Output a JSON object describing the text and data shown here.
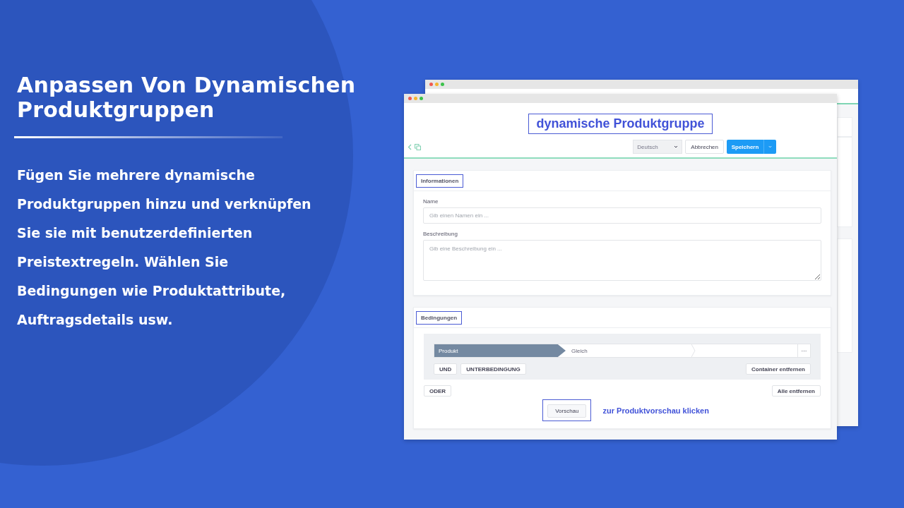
{
  "slide": {
    "title": "Anpassen Von Dynamischen Produktgruppen",
    "description": "Fügen Sie mehrere dynamische Produktgruppen hinzu und verknüpfen Sie sie mit benutzerdefinierten Preistextregeln. Wählen Sie Bedingungen wie Produktattribute, Auftragsdetails usw."
  },
  "window": {
    "heading": "dynamische Produktgruppe",
    "toolbar": {
      "language": "Deutsch",
      "cancel": "Abbrechen",
      "save": "Speichern"
    },
    "information": {
      "title": "Informationen",
      "fields": [
        {
          "label": "Name",
          "placeholder": "Gib einen Namen ein ...",
          "kind": "input"
        },
        {
          "label": "Beschreibung",
          "placeholder": "Gib eine Beschreibung ein ...",
          "kind": "textarea"
        }
      ]
    },
    "conditions": {
      "title": "Bedingungen",
      "rule": {
        "field": "Produkt",
        "operator": "Gleich",
        "more": "···"
      },
      "container_buttons": [
        "UND",
        "UNTERBEDINGUNG"
      ],
      "remove_container": "Container entfernen",
      "or": "ODER",
      "remove_all": "Alle entfernen",
      "preview": "Vorschau",
      "preview_hint": "zur Produktvorschau klicken"
    }
  }
}
